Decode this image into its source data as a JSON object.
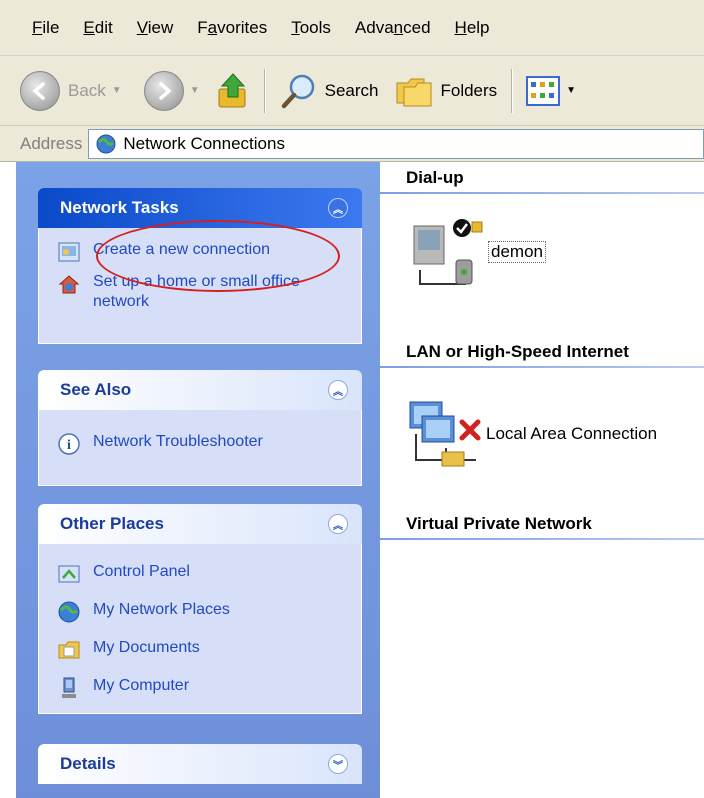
{
  "menu": [
    {
      "u": "F",
      "rest": "ile"
    },
    {
      "u": "E",
      "rest": "dit"
    },
    {
      "u": "V",
      "rest": "iew"
    },
    {
      "pre": "F",
      "u": "a",
      "rest": "vorites"
    },
    {
      "u": "T",
      "rest": "ools"
    },
    {
      "pre": "Adva",
      "u": "n",
      "rest": "ced"
    },
    {
      "u": "H",
      "rest": "elp"
    }
  ],
  "toolbar": {
    "back_label": "Back",
    "search_label": "Search",
    "folders_label": "Folders"
  },
  "address": {
    "label": "Address",
    "value": "Network Connections"
  },
  "taskpane": {
    "network_tasks": {
      "title": "Network Tasks",
      "items": [
        {
          "label": "Create a new connection",
          "icon": "new-connection-icon"
        },
        {
          "label": "Set up a home or small office network",
          "icon": "home-network-icon"
        }
      ]
    },
    "see_also": {
      "title": "See Also",
      "items": [
        {
          "label": "Network Troubleshooter",
          "icon": "info-icon"
        }
      ]
    },
    "other_places": {
      "title": "Other Places",
      "items": [
        {
          "label": "Control Panel",
          "icon": "control-panel-icon"
        },
        {
          "label": "My Network Places",
          "icon": "network-places-icon"
        },
        {
          "label": "My Documents",
          "icon": "documents-folder-icon"
        },
        {
          "label": "My Computer",
          "icon": "computer-icon"
        }
      ]
    },
    "details": {
      "title": "Details"
    }
  },
  "content": {
    "groups": [
      {
        "title": "Dial-up",
        "items": [
          {
            "label": "demon"
          }
        ]
      },
      {
        "title": "LAN or High-Speed Internet",
        "items": [
          {
            "label": "Local Area Connection"
          }
        ]
      },
      {
        "title": "Virtual Private Network",
        "items": []
      }
    ]
  },
  "colors": {
    "highlight": "#d62020",
    "task_link": "#2149c1",
    "header_dark": "#0a49c8"
  }
}
